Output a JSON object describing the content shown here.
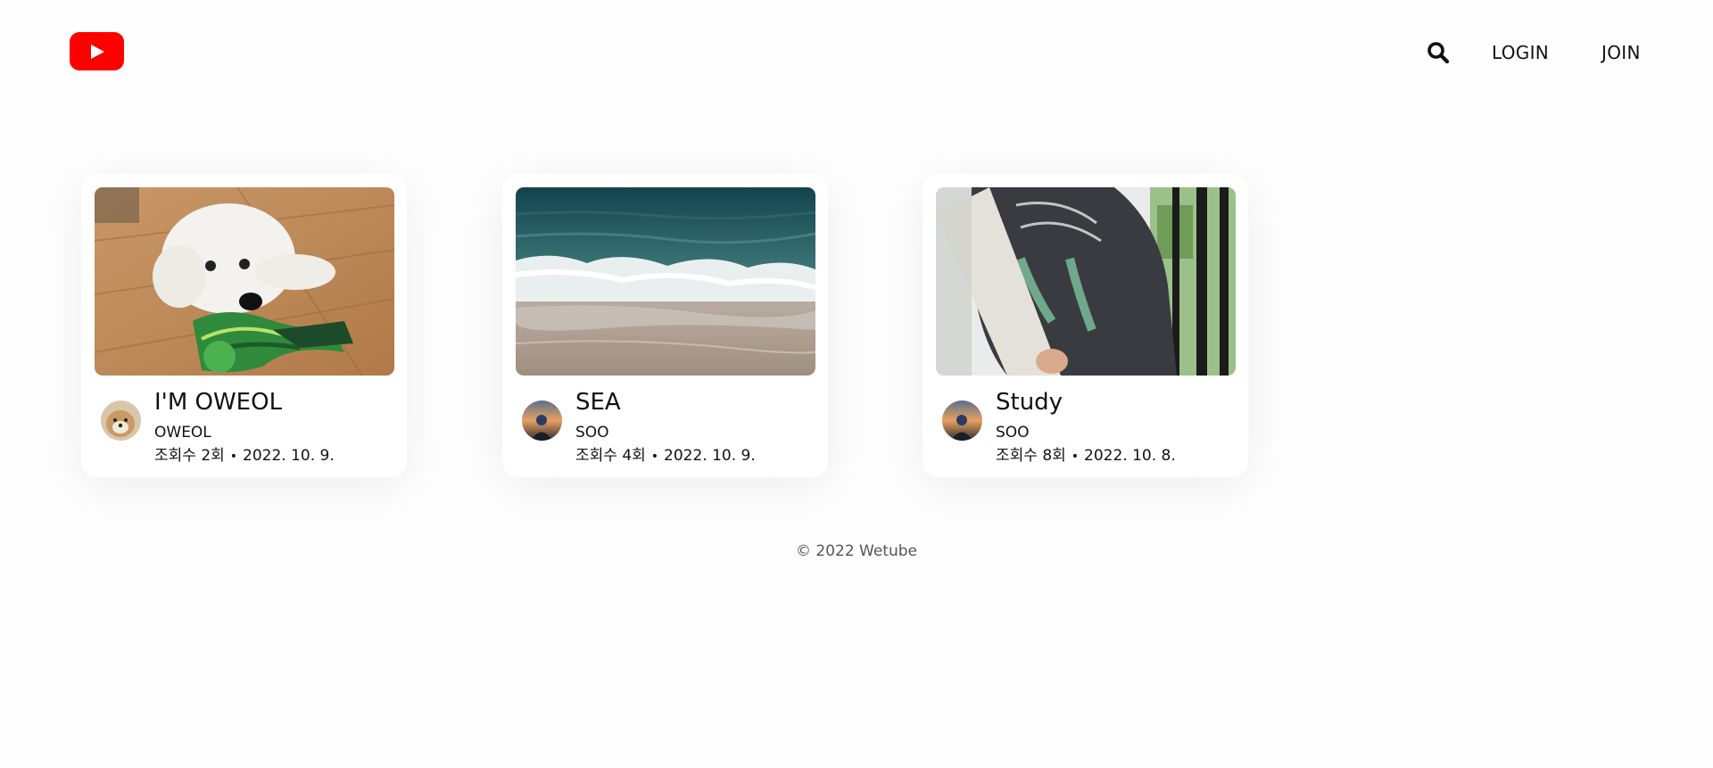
{
  "header": {
    "logo_icon": "youtube-play-logo",
    "search_icon": "search-icon",
    "login_label": "LOGIN",
    "join_label": "JOIN",
    "brand_color": "#ff0000"
  },
  "videos": [
    {
      "title": "I'M OWEOL",
      "owner": "OWEOL",
      "views": "조회수 2회",
      "separator": "•",
      "date": "2022. 10. 9.",
      "thumbnail": "dog-on-floor-photo",
      "avatar": "dog-avatar"
    },
    {
      "title": "SEA",
      "owner": "SOO",
      "views": "조회수 4회",
      "separator": "•",
      "date": "2022. 10. 9.",
      "thumbnail": "sea-waves-photo",
      "avatar": "sunset-avatar"
    },
    {
      "title": "Study",
      "owner": "SOO",
      "views": "조회수 8회",
      "separator": "•",
      "date": "2022. 10. 8.",
      "thumbnail": "hoodie-window-photo",
      "avatar": "sunset-avatar"
    }
  ],
  "footer": {
    "copyright": "© 2022 Wetube"
  }
}
